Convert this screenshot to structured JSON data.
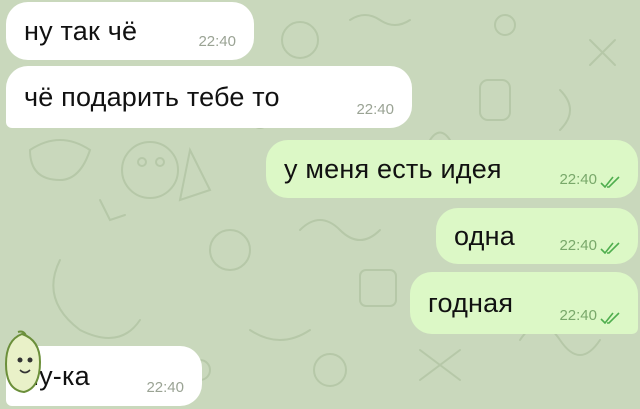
{
  "chat": {
    "messages": [
      {
        "direction": "in",
        "text": "ну так чё",
        "time": "22:40"
      },
      {
        "direction": "in",
        "text": "чё подарить тебе то",
        "time": "22:40"
      },
      {
        "direction": "out",
        "text": "у меня есть идея",
        "time": "22:40",
        "status": "read"
      },
      {
        "direction": "out",
        "text": "одна",
        "time": "22:40",
        "status": "read"
      },
      {
        "direction": "out",
        "text": "годная",
        "time": "22:40",
        "status": "read"
      },
      {
        "direction": "in",
        "text": "ну-ка",
        "time": "22:40"
      }
    ]
  },
  "icons": {
    "read_status": "double-check-icon",
    "sender_avatar": "sticker-avatar-icon",
    "background": "doodle-wallpaper"
  },
  "colors": {
    "wallpaper": "#c9d8bc",
    "incoming_bubble": "#ffffff",
    "outgoing_bubble": "#dcf8c6",
    "check_color": "#4fae4e"
  }
}
